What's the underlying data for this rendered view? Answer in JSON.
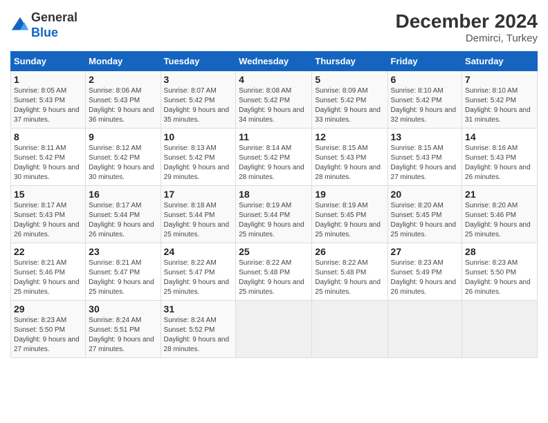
{
  "header": {
    "logo_line1": "General",
    "logo_line2": "Blue",
    "title": "December 2024",
    "subtitle": "Demirci, Turkey"
  },
  "weekdays": [
    "Sunday",
    "Monday",
    "Tuesday",
    "Wednesday",
    "Thursday",
    "Friday",
    "Saturday"
  ],
  "weeks": [
    [
      {
        "day": "1",
        "sunrise": "8:05 AM",
        "sunset": "5:43 PM",
        "daylight": "9 hours and 37 minutes."
      },
      {
        "day": "2",
        "sunrise": "8:06 AM",
        "sunset": "5:43 PM",
        "daylight": "9 hours and 36 minutes."
      },
      {
        "day": "3",
        "sunrise": "8:07 AM",
        "sunset": "5:42 PM",
        "daylight": "9 hours and 35 minutes."
      },
      {
        "day": "4",
        "sunrise": "8:08 AM",
        "sunset": "5:42 PM",
        "daylight": "9 hours and 34 minutes."
      },
      {
        "day": "5",
        "sunrise": "8:09 AM",
        "sunset": "5:42 PM",
        "daylight": "9 hours and 33 minutes."
      },
      {
        "day": "6",
        "sunrise": "8:10 AM",
        "sunset": "5:42 PM",
        "daylight": "9 hours and 32 minutes."
      },
      {
        "day": "7",
        "sunrise": "8:10 AM",
        "sunset": "5:42 PM",
        "daylight": "9 hours and 31 minutes."
      }
    ],
    [
      {
        "day": "8",
        "sunrise": "8:11 AM",
        "sunset": "5:42 PM",
        "daylight": "9 hours and 30 minutes."
      },
      {
        "day": "9",
        "sunrise": "8:12 AM",
        "sunset": "5:42 PM",
        "daylight": "9 hours and 30 minutes."
      },
      {
        "day": "10",
        "sunrise": "8:13 AM",
        "sunset": "5:42 PM",
        "daylight": "9 hours and 29 minutes."
      },
      {
        "day": "11",
        "sunrise": "8:14 AM",
        "sunset": "5:42 PM",
        "daylight": "9 hours and 28 minutes."
      },
      {
        "day": "12",
        "sunrise": "8:15 AM",
        "sunset": "5:43 PM",
        "daylight": "9 hours and 28 minutes."
      },
      {
        "day": "13",
        "sunrise": "8:15 AM",
        "sunset": "5:43 PM",
        "daylight": "9 hours and 27 minutes."
      },
      {
        "day": "14",
        "sunrise": "8:16 AM",
        "sunset": "5:43 PM",
        "daylight": "9 hours and 26 minutes."
      }
    ],
    [
      {
        "day": "15",
        "sunrise": "8:17 AM",
        "sunset": "5:43 PM",
        "daylight": "9 hours and 26 minutes."
      },
      {
        "day": "16",
        "sunrise": "8:17 AM",
        "sunset": "5:44 PM",
        "daylight": "9 hours and 26 minutes."
      },
      {
        "day": "17",
        "sunrise": "8:18 AM",
        "sunset": "5:44 PM",
        "daylight": "9 hours and 25 minutes."
      },
      {
        "day": "18",
        "sunrise": "8:19 AM",
        "sunset": "5:44 PM",
        "daylight": "9 hours and 25 minutes."
      },
      {
        "day": "19",
        "sunrise": "8:19 AM",
        "sunset": "5:45 PM",
        "daylight": "9 hours and 25 minutes."
      },
      {
        "day": "20",
        "sunrise": "8:20 AM",
        "sunset": "5:45 PM",
        "daylight": "9 hours and 25 minutes."
      },
      {
        "day": "21",
        "sunrise": "8:20 AM",
        "sunset": "5:46 PM",
        "daylight": "9 hours and 25 minutes."
      }
    ],
    [
      {
        "day": "22",
        "sunrise": "8:21 AM",
        "sunset": "5:46 PM",
        "daylight": "9 hours and 25 minutes."
      },
      {
        "day": "23",
        "sunrise": "8:21 AM",
        "sunset": "5:47 PM",
        "daylight": "9 hours and 25 minutes."
      },
      {
        "day": "24",
        "sunrise": "8:22 AM",
        "sunset": "5:47 PM",
        "daylight": "9 hours and 25 minutes."
      },
      {
        "day": "25",
        "sunrise": "8:22 AM",
        "sunset": "5:48 PM",
        "daylight": "9 hours and 25 minutes."
      },
      {
        "day": "26",
        "sunrise": "8:22 AM",
        "sunset": "5:48 PM",
        "daylight": "9 hours and 25 minutes."
      },
      {
        "day": "27",
        "sunrise": "8:23 AM",
        "sunset": "5:49 PM",
        "daylight": "9 hours and 26 minutes."
      },
      {
        "day": "28",
        "sunrise": "8:23 AM",
        "sunset": "5:50 PM",
        "daylight": "9 hours and 26 minutes."
      }
    ],
    [
      {
        "day": "29",
        "sunrise": "8:23 AM",
        "sunset": "5:50 PM",
        "daylight": "9 hours and 27 minutes."
      },
      {
        "day": "30",
        "sunrise": "8:24 AM",
        "sunset": "5:51 PM",
        "daylight": "9 hours and 27 minutes."
      },
      {
        "day": "31",
        "sunrise": "8:24 AM",
        "sunset": "5:52 PM",
        "daylight": "9 hours and 28 minutes."
      },
      null,
      null,
      null,
      null
    ]
  ]
}
